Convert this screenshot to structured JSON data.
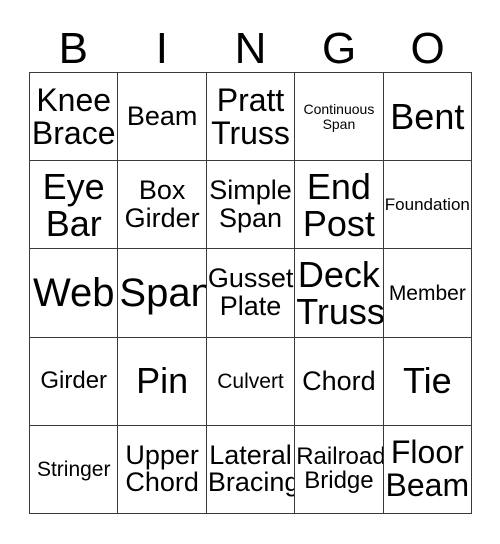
{
  "card": {
    "type": "bingo-card",
    "columns": 5,
    "rows": 5,
    "header_letters": [
      "B",
      "I",
      "N",
      "G",
      "O"
    ],
    "background_color": "#ffffff",
    "text_color": "#000000",
    "border_color": "#3a3a3a",
    "cells": [
      [
        {
          "text": "Knee\nBrace",
          "size": "lg",
          "lines": 2
        },
        {
          "text": "Beam",
          "size": "md",
          "lines": 1
        },
        {
          "text": "Pratt\nTruss",
          "size": "lg",
          "lines": 2
        },
        {
          "text": "Continuous\nSpan",
          "size": "tiny",
          "lines": 2
        },
        {
          "text": "Bent",
          "size": "xl",
          "lines": 1
        }
      ],
      [
        {
          "text": "Eye\nBar",
          "size": "xl",
          "lines": 2
        },
        {
          "text": "Box\nGirder",
          "size": "md",
          "lines": 2
        },
        {
          "text": "Simple\nSpan",
          "size": "md",
          "lines": 2
        },
        {
          "text": "End\nPost",
          "size": "xl",
          "lines": 2
        },
        {
          "text": "Foundation",
          "size": "xxs",
          "lines": 1
        }
      ],
      [
        {
          "text": "Web",
          "size": "xxl",
          "lines": 1
        },
        {
          "text": "Span",
          "size": "xxl",
          "lines": 1
        },
        {
          "text": "Gusset\nPlate",
          "size": "md",
          "lines": 2
        },
        {
          "text": "Deck\nTruss",
          "size": "xl",
          "lines": 2
        },
        {
          "text": "Member",
          "size": "xs",
          "lines": 1
        }
      ],
      [
        {
          "text": "Girder",
          "size": "sm",
          "lines": 1
        },
        {
          "text": "Pin",
          "size": "xl",
          "lines": 1
        },
        {
          "text": "Culvert",
          "size": "xs",
          "lines": 1
        },
        {
          "text": "Chord",
          "size": "md",
          "lines": 1
        },
        {
          "text": "Tie",
          "size": "xl",
          "lines": 1
        }
      ],
      [
        {
          "text": "Stringer",
          "size": "xs",
          "lines": 1
        },
        {
          "text": "Upper\nChord",
          "size": "md",
          "lines": 2
        },
        {
          "text": "Lateral\nBracing",
          "size": "md",
          "lines": 2
        },
        {
          "text": "Railroad\nBridge",
          "size": "sm",
          "lines": 2
        },
        {
          "text": "Floor\nBeam",
          "size": "lg",
          "lines": 2
        }
      ]
    ]
  }
}
